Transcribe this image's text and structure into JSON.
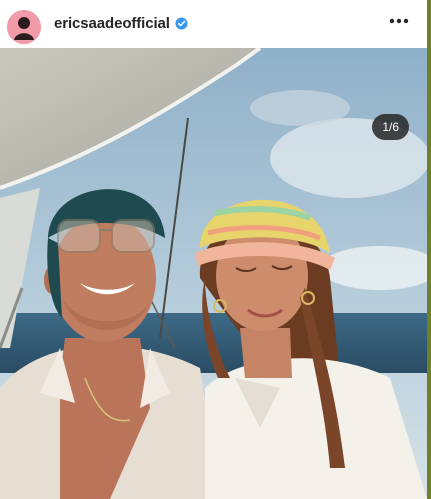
{
  "post": {
    "username": "ericsaadeofficial",
    "verified": true,
    "more_icon": "more-dots-icon",
    "media_counter": "1/6"
  },
  "colors": {
    "verified_blue": "#3897f0",
    "avatar_pink": "#f19aa8"
  }
}
